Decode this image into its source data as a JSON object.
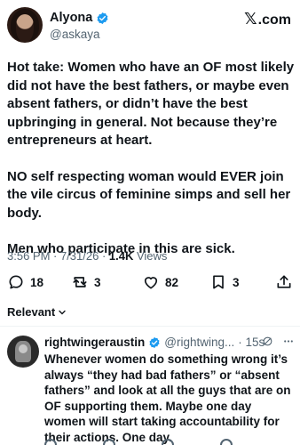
{
  "author": {
    "name": "Alyona",
    "handle": "@askaya",
    "verified_color": "#1d9bf0"
  },
  "brand": {
    "x_glyph": "𝕏",
    "domain": ".com"
  },
  "post": {
    "paragraphs": [
      "Hot take: Women who have an OF most likely did not have the best fathers, or maybe even absent fathers, or didn’t have the best upbringing in general. Not because they’re entrepreneurs at heart.",
      "NO self respecting woman would EVER join the vile circus of feminine simps and sell her body.",
      "Men who participate in this are sick."
    ],
    "time": "3:56 PM · 7/31/26 · ",
    "views_count": "1.4K",
    "views_label": " Views"
  },
  "actions": {
    "replies": "18",
    "reposts": "3",
    "likes": "82",
    "bookmarks": "3",
    "icons": [
      "reply-icon",
      "repost-icon",
      "like-icon",
      "bookmark-icon",
      "share-icon"
    ]
  },
  "sort": {
    "label": "Relevant",
    "icon": "chevron-down-icon"
  },
  "reply": {
    "name": "rightwingeraustin",
    "handle": "@rightwing...",
    "time": "· 15s",
    "text": "Whenever women do something wrong it’s always “they had bad fathers” or “absent fathers” and look at all the guys that are on OF supporting them.  Maybe one day women will start taking accountability for their actions.  One day."
  },
  "colors": {
    "text": "#0f1419",
    "secondary": "#536471",
    "accent": "#1d9bf0",
    "divider": "#eff3f4"
  }
}
